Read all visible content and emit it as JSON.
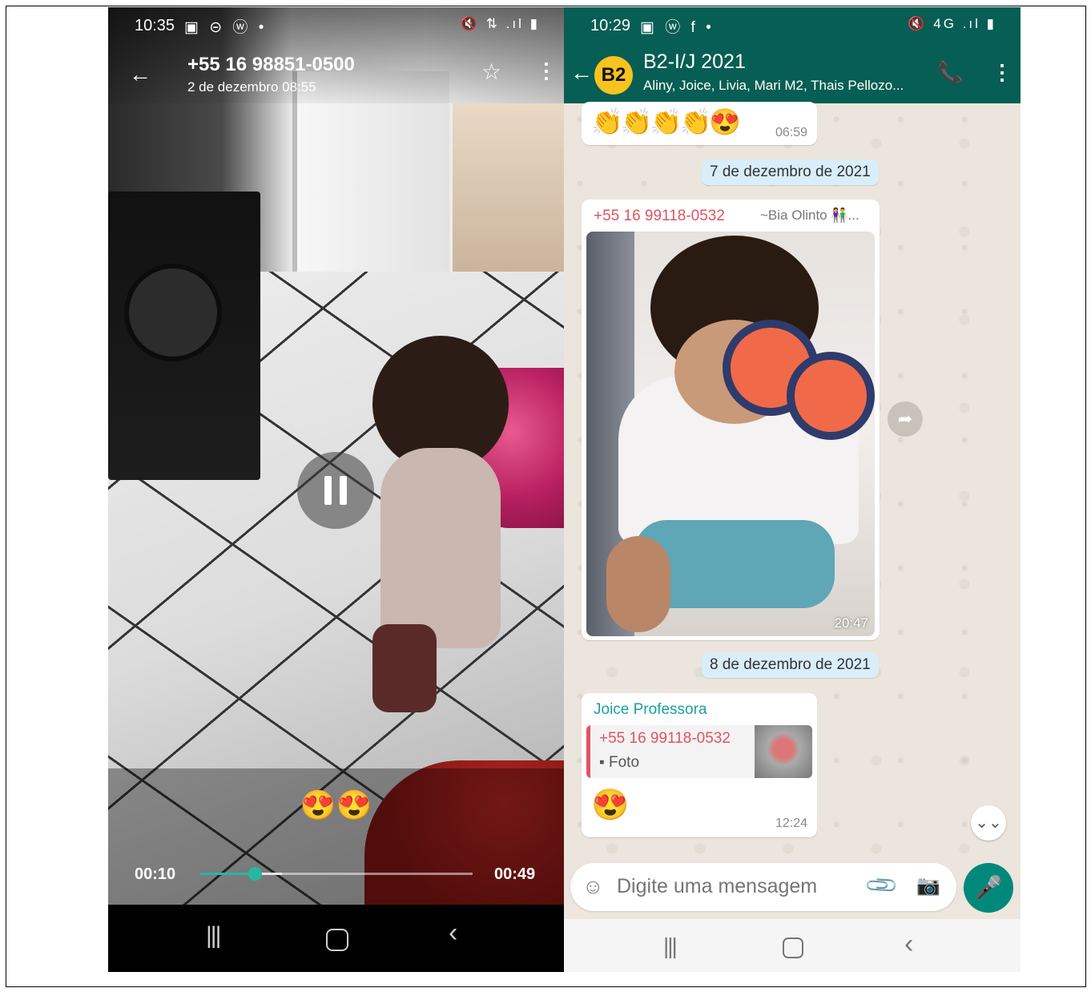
{
  "left": {
    "status": {
      "time": "10:35",
      "icons": "▣ ⊝ ⓦ •",
      "right": "🔇 ⇅ .ıl ▮"
    },
    "header": {
      "back": "←",
      "title": "+55 16 98851-0500",
      "subtitle": "2 de dezembro 08:55",
      "star": "☆",
      "more": "⋮"
    },
    "caption": "😍😍",
    "player": {
      "current": "00:10",
      "duration": "00:49",
      "progress_fraction": 0.2,
      "buffered_fraction": 0.3,
      "accent": "#25b7a5"
    },
    "nav": {
      "recents": "|||",
      "back": "‹"
    }
  },
  "right": {
    "status": {
      "time": "10:29",
      "icons": "▣ ⓦ f •",
      "right": "🔇 4G .ıl ▮"
    },
    "header": {
      "back": "←",
      "avatar": "B2",
      "name": "B2-I/J 2021",
      "members": "Aliny, Joice, Livia, Mari M2, Thais Pellozo...",
      "call": "📞",
      "more": "⋮",
      "color": "#075e54"
    },
    "messages": [
      {
        "content": "👏👏👏👏😍",
        "time": "06:59"
      },
      {
        "sender": "+55 16 99118-0532",
        "alias": "~Bia Olinto 👫...",
        "time": "20:47"
      },
      {
        "sender": "Joice Professora",
        "quote_name": "+55 16 99118-0532",
        "quote_type": "▪ Foto",
        "content": "😍",
        "time": "12:24"
      }
    ],
    "dates": [
      "7 de dezembro de 2021",
      "8 de dezembro de 2021"
    ],
    "forward_icon": "➦",
    "scroll_icon": "⌄⌄",
    "input": {
      "placeholder": "Digite uma mensagem",
      "emoji": "☺",
      "attach": "📎",
      "camera": "📷"
    },
    "mic": "🎤",
    "nav": {
      "recents": "|||",
      "back": "‹"
    }
  }
}
